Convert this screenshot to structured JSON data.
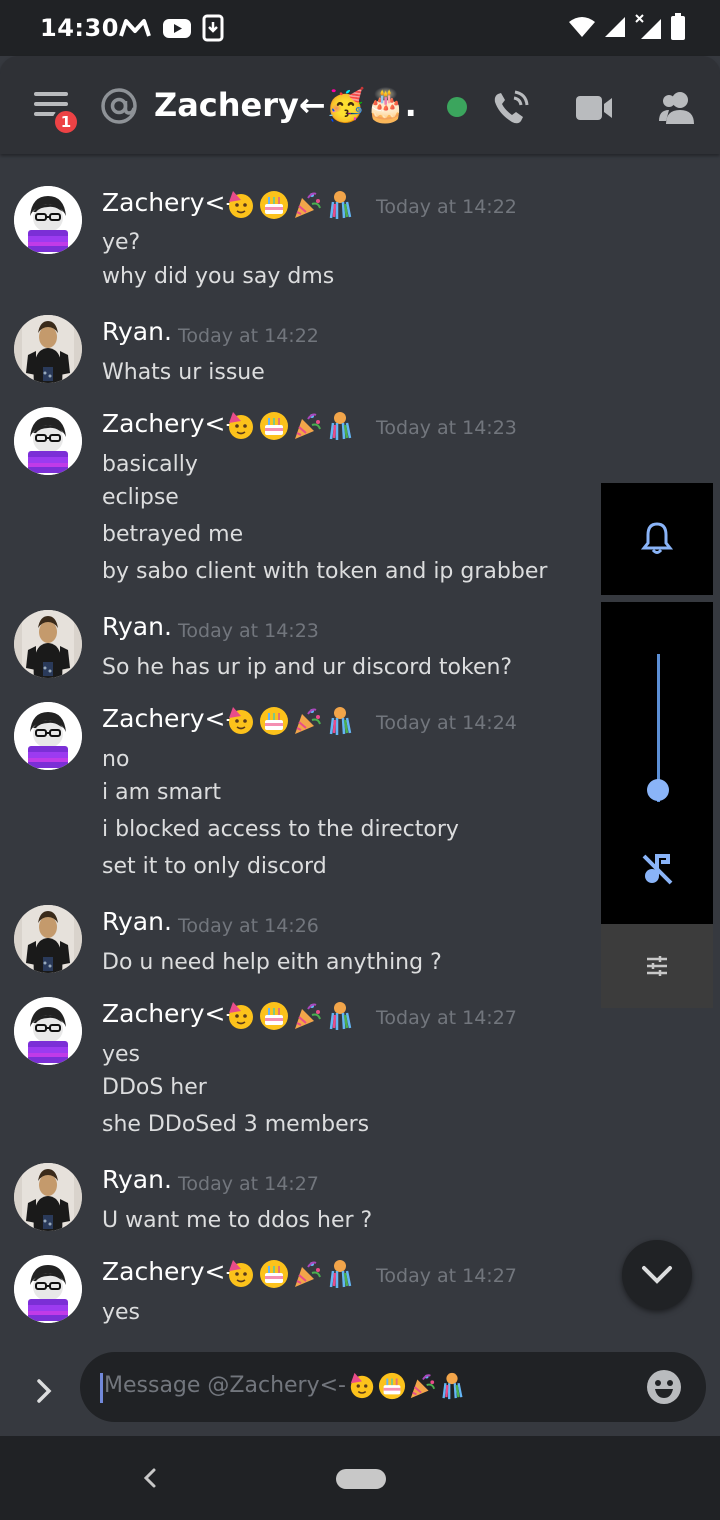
{
  "status_bar": {
    "time": "14:30",
    "left_icons": [
      "gmail-icon",
      "youtube-icon",
      "download-icon"
    ],
    "right_icons": [
      "wifi-icon",
      "signal-icon",
      "signal-x-icon",
      "battery-icon"
    ]
  },
  "header": {
    "menu_badge": "1",
    "channel_title": "Zachery←🥳🎂…",
    "online_status": "online",
    "icons": [
      "call-icon",
      "video-icon",
      "members-icon"
    ]
  },
  "messages": [
    {
      "author": "Zachery<-",
      "author_emojis": [
        "🥳",
        "🎂",
        "🎉",
        "🎊"
      ],
      "timestamp": "Today at 14:22",
      "lines": [
        "ye?",
        "why did you say dms"
      ]
    },
    {
      "author": "Ryan.",
      "author_emojis": [],
      "timestamp": "Today at 14:22",
      "lines": [
        "Whats ur issue"
      ]
    },
    {
      "author": "Zachery<-",
      "author_emojis": [
        "🥳",
        "🎂",
        "🎉",
        "🎊"
      ],
      "timestamp": "Today at 14:23",
      "lines": [
        "basically",
        "eclipse",
        "betrayed me",
        "by sabo client with token and ip grabber"
      ]
    },
    {
      "author": "Ryan.",
      "author_emojis": [],
      "timestamp": "Today at 14:23",
      "lines": [
        "So he has ur ip and ur discord token?"
      ]
    },
    {
      "author": "Zachery<-",
      "author_emojis": [
        "🥳",
        "🎂",
        "🎉",
        "🎊"
      ],
      "timestamp": "Today at 14:24",
      "lines": [
        "no",
        "i am smart",
        "i blocked access to the directory",
        "set it to only discord"
      ]
    },
    {
      "author": "Ryan.",
      "author_emojis": [],
      "timestamp": "Today at 14:26",
      "lines": [
        "Do u need help eith anything ?"
      ]
    },
    {
      "author": "Zachery<-",
      "author_emojis": [
        "🥳",
        "🎂",
        "🎉",
        "🎊"
      ],
      "timestamp": "Today at 14:27",
      "lines": [
        "yes",
        "DDoS her",
        "she DDoSed 3 members"
      ]
    },
    {
      "author": "Ryan.",
      "author_emojis": [],
      "timestamp": "Today at 14:27",
      "lines": [
        "U want me to ddos her ?"
      ]
    },
    {
      "author": "Zachery<-",
      "author_emojis": [
        "🥳",
        "🎂",
        "🎉",
        "🎊"
      ],
      "timestamp": "Today at 14:27",
      "lines": [
        "yes"
      ]
    }
  ],
  "volume_panel": {
    "level": 0.08,
    "icons": [
      "bell-icon",
      "music-off-icon",
      "equalizer-icon"
    ]
  },
  "composer": {
    "placeholder": "Message @Zachery<-",
    "placeholder_emojis": [
      "🥳",
      "🎂",
      "🎉",
      "🎊"
    ]
  },
  "colors": {
    "background": "#36393f",
    "header": "#2f3136",
    "composer": "#202225",
    "accent": "#7289da",
    "online": "#3ba55d",
    "badge": "#ed4245",
    "timestamp": "#72767d",
    "text": "#dcddde"
  }
}
